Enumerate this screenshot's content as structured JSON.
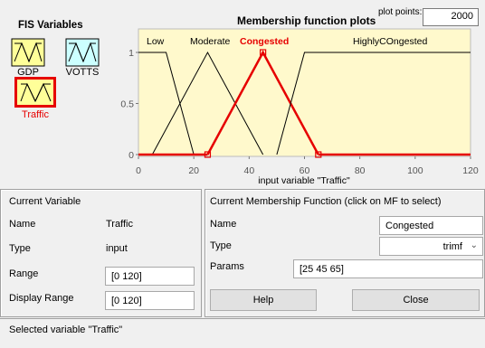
{
  "fis": {
    "title": "FIS Variables",
    "variables": [
      {
        "label": "GDP",
        "selected": false
      },
      {
        "label": "VOTTS",
        "selected": false
      },
      {
        "label": "Traffic",
        "selected": true
      }
    ]
  },
  "plot": {
    "title": "Membership function plots",
    "plot_points_label": "plot points:",
    "plot_points_value": "2000"
  },
  "chart_data": {
    "type": "line",
    "xlabel": "input variable \"Traffic\"",
    "xlim": [
      0,
      120
    ],
    "ylim": [
      0,
      1
    ],
    "xticks": [
      0,
      20,
      40,
      60,
      80,
      100,
      120
    ],
    "yticks": [
      "0",
      "0.5",
      "1"
    ],
    "series": [
      {
        "name": "Low",
        "params": [
          0,
          5,
          20
        ],
        "shape": "trapmf-left",
        "points": [
          [
            0,
            1
          ],
          [
            10,
            1
          ],
          [
            20,
            0
          ]
        ],
        "selected": false
      },
      {
        "name": "Moderate",
        "points": [
          [
            5,
            0
          ],
          [
            25,
            1
          ],
          [
            45,
            0
          ]
        ],
        "selected": false
      },
      {
        "name": "Congested",
        "points": [
          [
            25,
            0
          ],
          [
            45,
            1
          ],
          [
            65,
            0
          ]
        ],
        "selected": true
      },
      {
        "name": "HighlyCOngested",
        "points": [
          [
            50,
            0
          ],
          [
            60,
            1
          ],
          [
            120,
            1
          ]
        ],
        "selected": false
      }
    ],
    "colors": {
      "background": "#fff9cc",
      "line": "#000000",
      "selected": "#e60000"
    }
  },
  "current_variable": {
    "title": "Current Variable",
    "name_label": "Name",
    "name_value": "Traffic",
    "type_label": "Type",
    "type_value": "input",
    "range_label": "Range",
    "range_value": "[0 120]",
    "display_range_label": "Display Range",
    "display_range_value": "[0 120]"
  },
  "current_mf": {
    "title": "Current Membership Function (click on MF to select)",
    "name_label": "Name",
    "name_value": "Congested",
    "type_label": "Type",
    "type_value": "trimf",
    "params_label": "Params",
    "params_value": "[25 45 65]",
    "help_label": "Help",
    "close_label": "Close"
  },
  "status": {
    "text": "Selected variable \"Traffic\""
  }
}
